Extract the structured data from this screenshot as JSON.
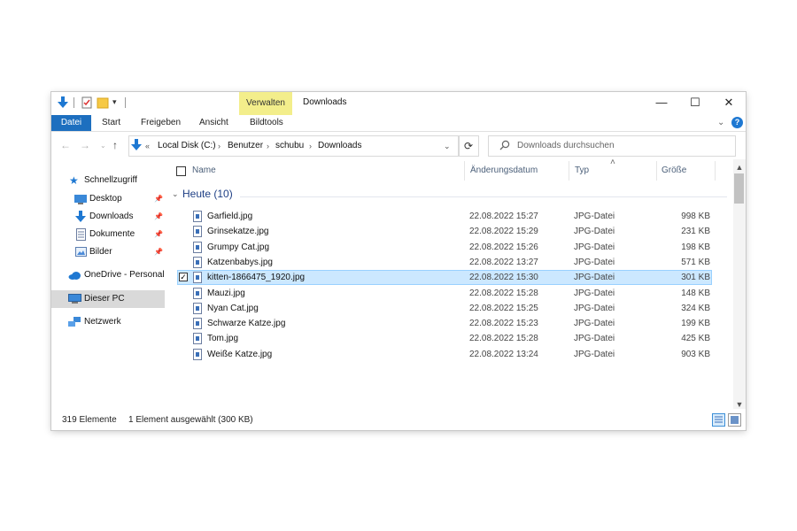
{
  "window": {
    "title": "Downloads",
    "context_tab": "Verwalten",
    "controls": {
      "minimize": "—",
      "maximize": "☐",
      "close": "✕"
    }
  },
  "ribbon": {
    "tabs": [
      "Datei",
      "Start",
      "Freigeben",
      "Ansicht",
      "Bildtools"
    ],
    "expand_glyph": "⌄",
    "help": "?"
  },
  "address": {
    "crumbs": [
      "Local Disk (C:)",
      "Benutzer",
      "schubu",
      "Downloads"
    ],
    "overflow": "«",
    "search_placeholder": "Downloads durchsuchen"
  },
  "nav": {
    "quick_access": "Schnellzugriff",
    "items": [
      {
        "label": "Desktop",
        "icon": "desktop-icon",
        "pinned": true
      },
      {
        "label": "Downloads",
        "icon": "download-arrow-icon",
        "pinned": true
      },
      {
        "label": "Dokumente",
        "icon": "documents-icon",
        "pinned": true
      },
      {
        "label": "Bilder",
        "icon": "pictures-icon",
        "pinned": true
      }
    ],
    "onedrive": "OneDrive - Personal",
    "this_pc": "Dieser PC",
    "network": "Netzwerk"
  },
  "list": {
    "columns": {
      "name": "Name",
      "date": "Änderungsdatum",
      "type": "Typ",
      "size": "Größe"
    },
    "sort_glyph": "˄",
    "group_label": "Heute (10)",
    "files": [
      {
        "name": "Garfield.jpg",
        "date": "22.08.2022 15:27",
        "type": "JPG-Datei",
        "size": "998 KB"
      },
      {
        "name": "Grinsekatze.jpg",
        "date": "22.08.2022 15:29",
        "type": "JPG-Datei",
        "size": "231 KB"
      },
      {
        "name": "Grumpy Cat.jpg",
        "date": "22.08.2022 15:26",
        "type": "JPG-Datei",
        "size": "198 KB"
      },
      {
        "name": "Katzenbabys.jpg",
        "date": "22.08.2022 13:27",
        "type": "JPG-Datei",
        "size": "571 KB"
      },
      {
        "name": "kitten-1866475_1920.jpg",
        "date": "22.08.2022 15:30",
        "type": "JPG-Datei",
        "size": "301 KB",
        "selected": true
      },
      {
        "name": "Mauzi.jpg",
        "date": "22.08.2022 15:28",
        "type": "JPG-Datei",
        "size": "148 KB"
      },
      {
        "name": "Nyan Cat.jpg",
        "date": "22.08.2022 15:25",
        "type": "JPG-Datei",
        "size": "324 KB"
      },
      {
        "name": "Schwarze Katze.jpg",
        "date": "22.08.2022 15:23",
        "type": "JPG-Datei",
        "size": "199 KB"
      },
      {
        "name": "Tom.jpg",
        "date": "22.08.2022 15:28",
        "type": "JPG-Datei",
        "size": "425 KB"
      },
      {
        "name": "Weiße Katze.jpg",
        "date": "22.08.2022 13:24",
        "type": "JPG-Datei",
        "size": "903 KB"
      }
    ]
  },
  "status": {
    "count": "319 Elemente",
    "selection": "1 Element ausgewählt (300 KB)"
  },
  "colors": {
    "file_tab": "#1d6fbf",
    "context_tab": "#f3ee8b",
    "selection_bg": "#cce8ff",
    "selection_border": "#99d1ff",
    "group_header": "#1e3f85",
    "nav_selected": "#d9d9d9"
  }
}
